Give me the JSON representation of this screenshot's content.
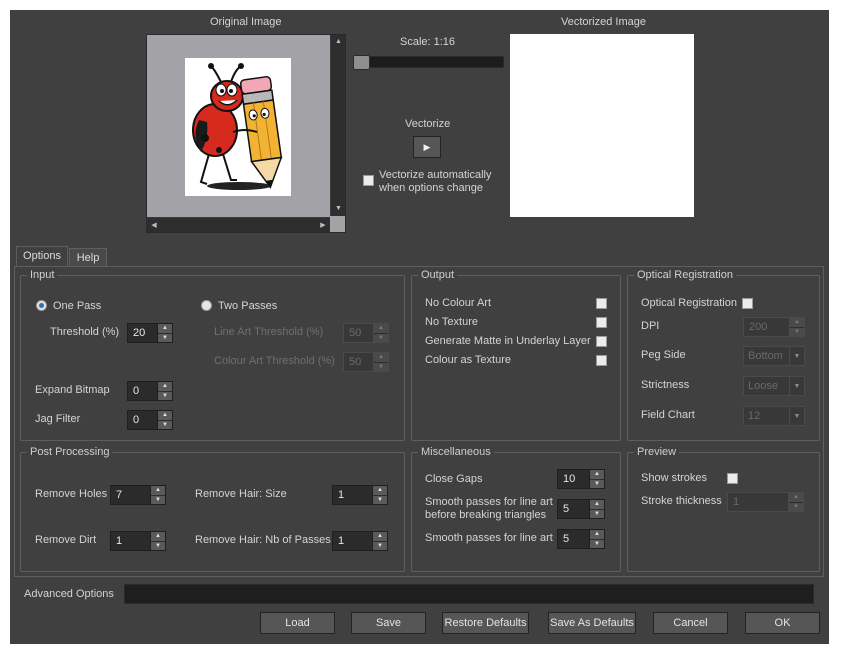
{
  "preview": {
    "original_label": "Original Image",
    "vectorized_label": "Vectorized Image",
    "scale_label": "Scale: 1:16",
    "vectorize_label": "Vectorize",
    "auto_vectorize_line1": "Vectorize automatically",
    "auto_vectorize_line2": "when options change"
  },
  "tabs": [
    {
      "label": "Options",
      "active": true
    },
    {
      "label": "Help",
      "active": false
    }
  ],
  "input": {
    "title": "Input",
    "one_pass": "One Pass",
    "two_passes": "Two Passes",
    "threshold_label": "Threshold (%)",
    "threshold_value": "20",
    "line_art_label": "Line Art Threshold (%)",
    "line_art_value": "50",
    "colour_art_label": "Colour Art Threshold (%)",
    "colour_art_value": "50",
    "expand_label": "Expand Bitmap",
    "expand_value": "0",
    "jag_label": "Jag Filter",
    "jag_value": "0"
  },
  "output": {
    "title": "Output",
    "no_colour_art": "No Colour Art",
    "no_texture": "No Texture",
    "generate_matte": "Generate Matte in Underlay Layer",
    "colour_as_texture": "Colour as Texture"
  },
  "optical": {
    "title": "Optical Registration",
    "checkbox_label": "Optical Registration",
    "dpi_label": "DPI",
    "dpi_value": "200",
    "peg_label": "Peg Side",
    "peg_value": "Bottom",
    "strictness_label": "Strictness",
    "strictness_value": "Loose",
    "field_label": "Field Chart",
    "field_value": "12"
  },
  "post": {
    "title": "Post Processing",
    "holes_label": "Remove Holes",
    "holes_value": "7",
    "dirt_label": "Remove Dirt",
    "dirt_value": "1",
    "hair_size_label": "Remove Hair: Size",
    "hair_size_value": "1",
    "hair_passes_label": "Remove Hair: Nb of Passes",
    "hair_passes_value": "1"
  },
  "misc": {
    "title": "Miscellaneous",
    "close_gaps_label": "Close Gaps",
    "close_gaps_value": "10",
    "smooth_before_line1": "Smooth passes for line art",
    "smooth_before_line2": "before breaking triangles",
    "smooth_before_value": "5",
    "smooth_label": "Smooth passes for line art",
    "smooth_value": "5"
  },
  "preview_group": {
    "title": "Preview",
    "show_strokes_label": "Show strokes",
    "stroke_thickness_label": "Stroke thickness",
    "stroke_thickness_value": "1"
  },
  "advanced": {
    "label": "Advanced Options",
    "value": ""
  },
  "buttons": {
    "load": "Load",
    "save": "Save",
    "restore": "Restore Defaults",
    "save_defaults": "Save As Defaults",
    "cancel": "Cancel",
    "ok": "OK"
  },
  "icons": {
    "play": "play-icon",
    "scroll_up": "arrow-up-icon",
    "scroll_down": "arrow-down-icon",
    "scroll_left": "arrow-left-icon",
    "scroll_right": "arrow-right-icon"
  },
  "colors": {
    "dialog_bg": "#404040",
    "radio_selected": "#2f6fb6",
    "preview_bg": "#a3a3a7",
    "vectorized_bg": "#ffffff"
  }
}
